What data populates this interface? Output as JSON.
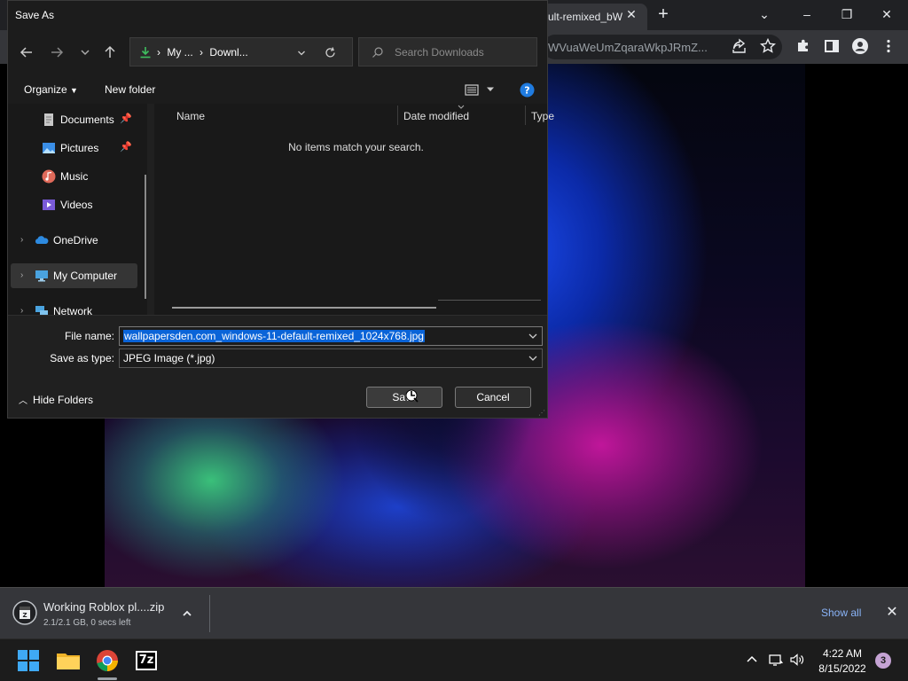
{
  "browser": {
    "tab_title": "ult-remixed_bW",
    "address_text": "WVuaWeUmZqaraWkpJRmZ...",
    "win_minimize": "–",
    "win_restore": "❐",
    "win_close": "✕",
    "tab_close": "✕",
    "new_tab": "+",
    "tab_search": "⌄"
  },
  "dialog": {
    "title": "Save As",
    "breadcrumb": [
      "My ...",
      "Downl..."
    ],
    "search_placeholder": "Search Downloads",
    "organize_label": "Organize",
    "new_folder_label": "New folder",
    "sidebar": {
      "items": [
        {
          "label": "Documents",
          "pinned": true
        },
        {
          "label": "Pictures",
          "pinned": true
        },
        {
          "label": "Music"
        },
        {
          "label": "Videos"
        },
        {
          "label": "OneDrive"
        },
        {
          "label": "My Computer",
          "selected": true
        },
        {
          "label": "Network"
        }
      ]
    },
    "columns": [
      "Name",
      "Date modified",
      "Type"
    ],
    "empty_message": "No items match your search.",
    "file_name_label": "File name:",
    "file_name_value": "wallpapersden.com_windows-11-default-remixed_1024x768.jpg",
    "save_type_label": "Save as type:",
    "save_type_value": "JPEG Image (*.jpg)",
    "hide_folders_label": "Hide Folders",
    "save_label": "Save",
    "cancel_label": "Cancel"
  },
  "downloads": {
    "file_name": "Working Roblox pl....zip",
    "status": "2.1/2.1 GB, 0 secs left",
    "show_all": "Show all",
    "close": "✕"
  },
  "taskbar": {
    "apps": [
      "windows-start-icon",
      "file-explorer-icon",
      "chrome-icon",
      "7zip-icon"
    ],
    "zip_label": "7z",
    "time": "4:22 AM",
    "date": "8/15/2022",
    "notification_count": "3"
  },
  "colors": {
    "accent": "#0a64d8",
    "link": "#8ab4f8",
    "dialog_bg": "#202020",
    "taskbar_bg": "#1c1c1c"
  }
}
